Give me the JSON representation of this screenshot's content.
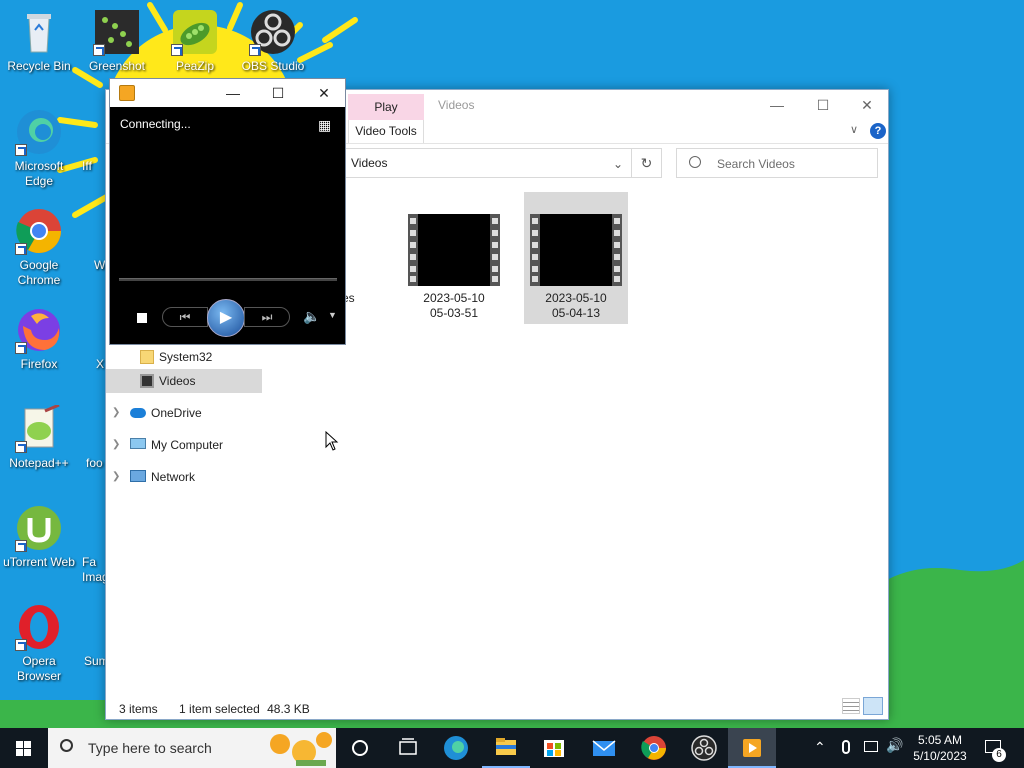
{
  "desktop": {
    "icons": [
      {
        "label": "Recycle Bin"
      },
      {
        "label": "Greenshot"
      },
      {
        "label": "PeaZip"
      },
      {
        "label": "OBS Studio"
      },
      {
        "label": "Microsoft Edge"
      },
      {
        "label": "Google Chrome"
      },
      {
        "label": "Firefox"
      },
      {
        "label": "Notepad++"
      },
      {
        "label": "uTorrent Web"
      },
      {
        "label": "Opera Browser"
      },
      {
        "label": "Iff"
      },
      {
        "label": "W"
      },
      {
        "label": "X"
      },
      {
        "label": "foo"
      },
      {
        "label": "Fa Imag"
      },
      {
        "label": "Sum"
      }
    ]
  },
  "explorer": {
    "context_tab": "Play",
    "title": "Videos",
    "ribbon_tab": "Video Tools",
    "address": "Videos",
    "search_placeholder": "Search Videos",
    "hidden_folder_partial": "es",
    "nav": {
      "system32": "System32",
      "videos": "Videos",
      "onedrive": "OneDrive",
      "my_computer": "My Computer",
      "network": "Network"
    },
    "files": [
      {
        "line1": "2023-05-10",
        "line2": "05-03-51"
      },
      {
        "line1": "2023-05-10",
        "line2": "05-04-13"
      }
    ],
    "status": {
      "items": "3 items",
      "selected": "1 item selected",
      "size": "48.3 KB"
    }
  },
  "player": {
    "status_text": "Connecting..."
  },
  "taskbar": {
    "search_placeholder": "Type here to search",
    "time": "5:05 AM",
    "date": "5/10/2023",
    "notification_count": "6"
  },
  "colors": {
    "sky": "#1a9be0",
    "grass": "#3bb54a",
    "sun": "#ffe81a",
    "taskbar": "#101820",
    "context_tab": "#f9d6e6"
  }
}
